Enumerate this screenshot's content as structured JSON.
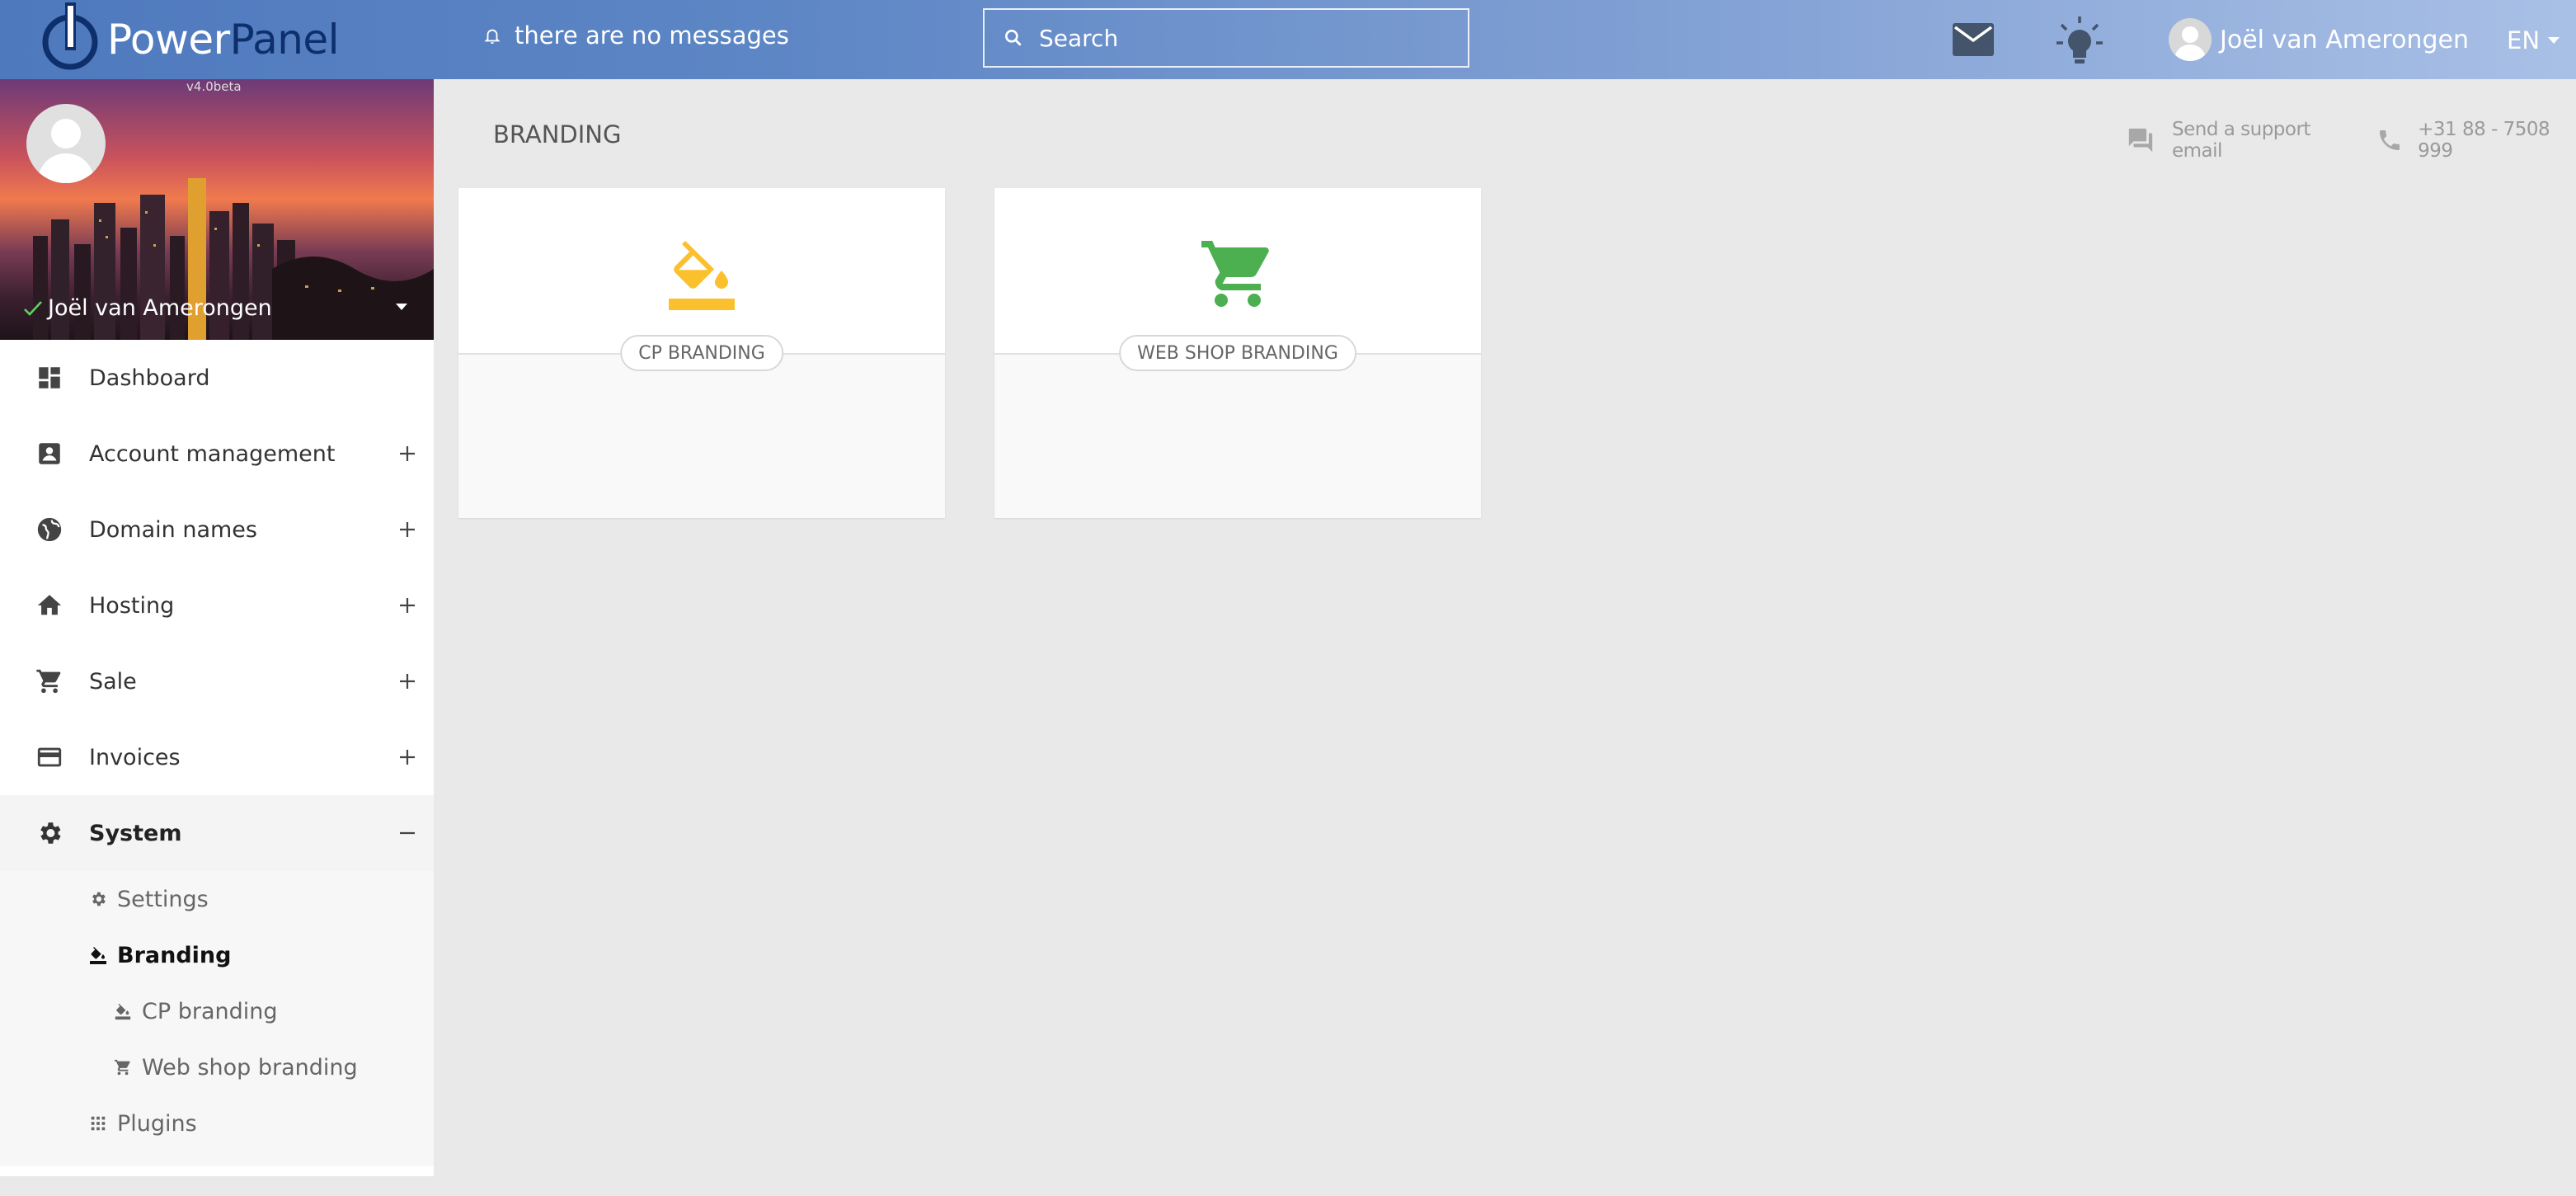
{
  "topbar": {
    "logo": {
      "part1": "Power",
      "part2": "Panel"
    },
    "messages": "there are no messages",
    "search_placeholder": "Search",
    "user_name": "Joël van Amerongen",
    "language": "EN",
    "icons": {
      "bell": "bell-icon",
      "search": "search-icon",
      "mail": "mail-icon",
      "bulb": "lightbulb-icon",
      "avatar": "avatar-icon"
    }
  },
  "sidebar": {
    "version": "v4.0beta",
    "user_name": "Joël van Amerongen",
    "items": [
      {
        "label": "Dashboard",
        "icon": "dashboard-icon",
        "expandable": false
      },
      {
        "label": "Account management",
        "icon": "account-box-icon",
        "expandable": true
      },
      {
        "label": "Domain names",
        "icon": "globe-icon",
        "expandable": true
      },
      {
        "label": "Hosting",
        "icon": "home-icon",
        "expandable": true
      },
      {
        "label": "Sale",
        "icon": "cart-icon",
        "expandable": true
      },
      {
        "label": "Invoices",
        "icon": "credit-card-icon",
        "expandable": true
      },
      {
        "label": "System",
        "icon": "gear-icon",
        "expandable": true,
        "expanded": true
      }
    ],
    "system_sub": [
      {
        "label": "Settings",
        "icon": "gear-icon"
      },
      {
        "label": "Branding",
        "icon": "paint-bucket-icon",
        "current": true
      },
      {
        "label": "CP branding",
        "icon": "paint-bucket-icon"
      },
      {
        "label": "Web shop branding",
        "icon": "cart-icon"
      },
      {
        "label": "Plugins",
        "icon": "grid-icon"
      }
    ]
  },
  "main": {
    "title": "BRANDING",
    "support_email": "Send a support email",
    "support_phone": "+31 88 - 7508 999",
    "cards": [
      {
        "label": "CP BRANDING",
        "icon": "paint-bucket-icon",
        "color": "#fbc02d"
      },
      {
        "label": "WEB SHOP BRANDING",
        "icon": "cart-icon",
        "color": "#4caf50"
      }
    ]
  },
  "colors": {
    "accent": "#4e79bd",
    "bucket": "#fbc02d",
    "cart": "#4caf50"
  }
}
